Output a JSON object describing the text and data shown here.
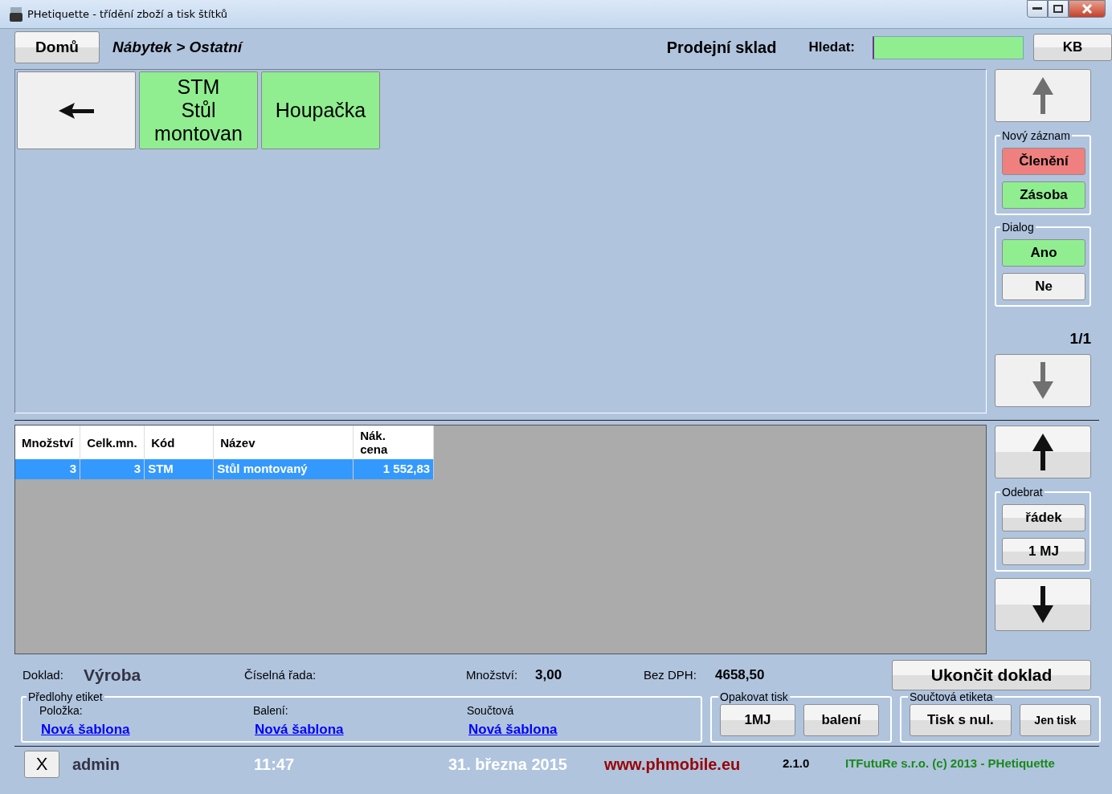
{
  "window": {
    "title": "PHetiquette - třídění zboží a tisk štítků"
  },
  "header": {
    "home_button": "Domů",
    "breadcrumb": "Nábytek > Ostatní",
    "store": "Prodejní sklad",
    "search_label": "Hledat:",
    "keyboard_button": "KB"
  },
  "tiles": [
    {
      "kind": "back"
    },
    {
      "kind": "category",
      "label": "STM\nStůl\nmontovan"
    },
    {
      "kind": "category",
      "label": "Houpačka"
    }
  ],
  "tile_up": {
    "disabled": true
  },
  "new_record": {
    "title": "Nový záznam",
    "buttons": [
      {
        "label": "Členění",
        "color": "#f08080"
      },
      {
        "label": "Zásoba",
        "color": "#90ee90"
      }
    ]
  },
  "dialog": {
    "title": "Dialog",
    "buttons": [
      {
        "label": "Ano",
        "color": "#90ee90"
      },
      {
        "label": "Ne",
        "color": "#f0f0f0"
      }
    ]
  },
  "page_indicator": "1/1",
  "tile_down": {
    "disabled": true
  },
  "table": {
    "columns": [
      "Množství",
      "Celk.mn.",
      "Kód",
      "Název",
      "Nák.\ncena"
    ],
    "rows": [
      {
        "cells": [
          "3",
          "3",
          "STM",
          "Stůl montovaný",
          "1 552,83"
        ],
        "selected": true
      }
    ]
  },
  "row_up": {
    "disabled": false
  },
  "remove": {
    "title": "Odebrat",
    "buttons": [
      "řádek",
      "1 MJ"
    ]
  },
  "row_down": {
    "disabled": false
  },
  "summary": {
    "document_label": "Doklad:",
    "document_value": "Výroba",
    "series_label": "Číselná řada:",
    "quantity_label": "Množství:",
    "quantity_value": "3,00",
    "net_label": "Bez DPH:",
    "net_value": "4658,50",
    "finish_button": "Ukončit doklad"
  },
  "templates": {
    "title": "Předlohy etiket",
    "items": [
      {
        "label": "Položka:",
        "link": "Nová šablona"
      },
      {
        "label": "Balení:",
        "link": "Nová šablona"
      },
      {
        "label": "Součtová",
        "link": "Nová šablona"
      }
    ]
  },
  "repeat_print": {
    "title": "Opakovat tisk",
    "buttons": [
      "1MJ",
      "balení"
    ]
  },
  "sum_label": {
    "title": "Součtová etiketa",
    "buttons": [
      "Tisk s nul.",
      "Jen tisk"
    ]
  },
  "status_bar": {
    "close_button": "X",
    "user": "admin",
    "time": "11:47",
    "date": "31. března 2015",
    "website": "www.phmobile.eu",
    "version": "2.1.0",
    "copyright": "ITFutuRe s.r.o. (c) 2013 - PHetiquette"
  }
}
